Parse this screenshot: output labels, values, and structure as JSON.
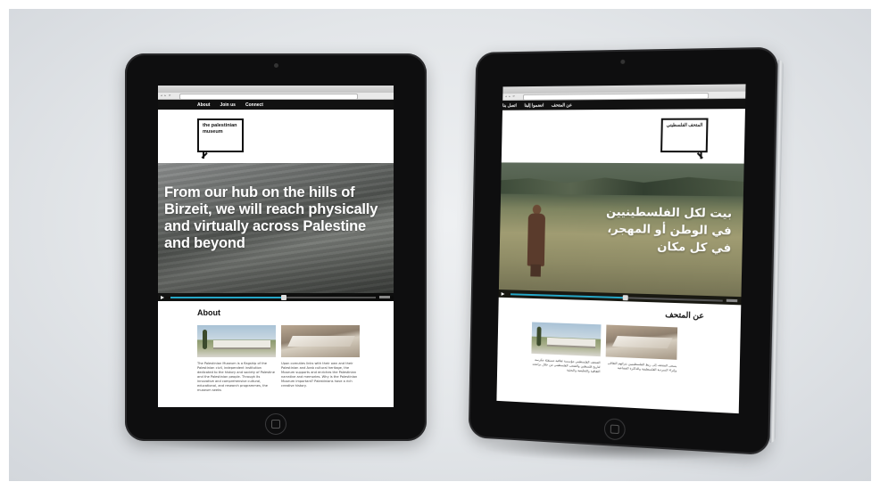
{
  "left_ipad": {
    "browser": {
      "title": "",
      "url": ""
    },
    "nav": [
      "About",
      "Join us",
      "Connect"
    ],
    "logo_text": "the palestinian museum",
    "hero_text": "From our hub on the hills of Birzeit, we will reach physically and virtually across Palestine and beyond",
    "section_title": "About",
    "col1_text": "The Palestinian Museum is a flagship of the Palestinian civil, independent institution dedicated to the history and society of Palestine and the Palestinian people. Through its innovative and comprehensive cultural, educational, and research programmes, the museum seeks",
    "col2_text": "Upon comuties links with their own and their Palestinian and Arab cultural heritage, the Museum supports and enriches the Palestinian narrative and memories. Why is the Palestinian Museum important? Palestinians have a rich creative history."
  },
  "right_ipad": {
    "browser": {
      "title": "",
      "url": ""
    },
    "nav": [
      "عن المتحف",
      "انضموا إلينا",
      "اتصل بنا"
    ],
    "logo_text": "المتحف الفلسطيني",
    "hero_text": "بيت لكل الفلسطينيين في الوطن أو المهجر، في كل مكان",
    "section_title": "عن المتحف",
    "col1_text": "المتحف الفلسطيني مؤسسة ثقافية مستقلة مكرسة لتاريخ فلسطين والشعب الفلسطيني من خلال برامجه الثقافية والتعليمية والبحثية",
    "col2_text": "يسعى المتحف إلى ربط الفلسطينيين بتراثهم الثقافي وإثراء السردية الفلسطينية والذاكرة الجماعية"
  },
  "player": {
    "accent_color": "#25a7c7",
    "progress_fraction": 0.55
  }
}
